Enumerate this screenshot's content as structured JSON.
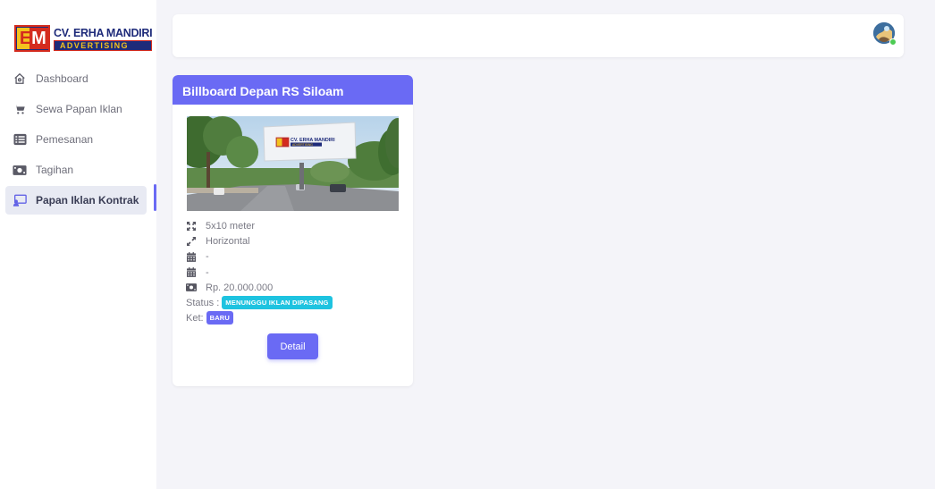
{
  "brand": {
    "logo_initials_e": "E",
    "logo_initials_m": "M",
    "name": "CV. ERHA MANDIRI",
    "subtitle": "ADVERTISING"
  },
  "sidebar": {
    "items": [
      {
        "label": "Dashboard",
        "icon": "home-icon",
        "active": false
      },
      {
        "label": "Sewa Papan Iklan",
        "icon": "cart-icon",
        "active": false
      },
      {
        "label": "Pemesanan",
        "icon": "list-icon",
        "active": false
      },
      {
        "label": "Tagihan",
        "icon": "money-icon",
        "active": false
      },
      {
        "label": "Papan Iklan Kontrak",
        "icon": "billboard-icon",
        "active": true
      }
    ]
  },
  "topbar": {
    "avatar_icon": "user-avatar",
    "online_status_color": "#4ccb53"
  },
  "card": {
    "title": "Billboard Depan RS Siloam",
    "image_billboard_name": "CV. ERHA MANDIRI",
    "image_billboard_sub": "ADVERTISING",
    "size": "5x10 meter",
    "orientation": "Horizontal",
    "start_date": "-",
    "end_date": "-",
    "price": "Rp. 20.000.000",
    "status_label": "Status :",
    "status_value": "MENUNGGU IKLAN DIPASANG",
    "ket_label": "Ket:",
    "ket_value": "BARU",
    "detail_button": "Detail"
  },
  "colors": {
    "accent": "#6a6af4",
    "status_badge": "#1ec3e0",
    "ket_badge": "#6a6af4"
  }
}
